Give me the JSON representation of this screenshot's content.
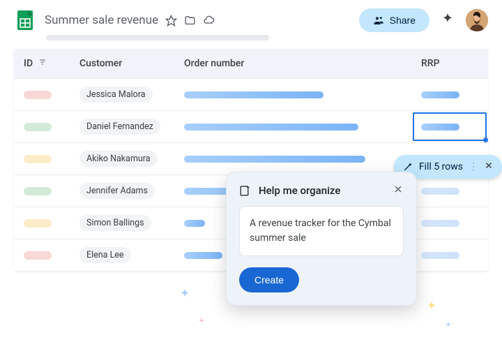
{
  "header": {
    "title": "Summer sale revenue",
    "share_label": "Share"
  },
  "table": {
    "columns": [
      "ID",
      "Customer",
      "Order number",
      "RRP"
    ],
    "rows": [
      {
        "id_color": "pill-red",
        "customer": "Jessica Malora",
        "order_width": 200,
        "rrp_width": 55,
        "rrp_selected": false,
        "rrp_faded": false
      },
      {
        "id_color": "pill-green",
        "customer": "Daniel Fernandez",
        "order_width": 250,
        "rrp_width": 55,
        "rrp_selected": true,
        "rrp_faded": false
      },
      {
        "id_color": "pill-yellow",
        "customer": "Akiko Nakamura",
        "order_width": 260,
        "rrp_width": 0,
        "rrp_selected": false,
        "rrp_faded": false
      },
      {
        "id_color": "pill-green",
        "customer": "Jennifer Adams",
        "order_width": 260,
        "rrp_width": 55,
        "rrp_selected": false,
        "rrp_faded": true
      },
      {
        "id_color": "pill-yellow",
        "customer": "Simon Ballings",
        "order_width": 30,
        "rrp_width": 55,
        "rrp_selected": false,
        "rrp_faded": true
      },
      {
        "id_color": "pill-red",
        "customer": "Elena Lee",
        "order_width": 55,
        "rrp_width": 55,
        "rrp_selected": false,
        "rrp_faded": true
      }
    ]
  },
  "fill_chip": {
    "label": "Fill 5 rows"
  },
  "organize": {
    "title": "Help me organize",
    "prompt": "A revenue tracker for the Cymbal summer sale",
    "create_label": "Create"
  }
}
